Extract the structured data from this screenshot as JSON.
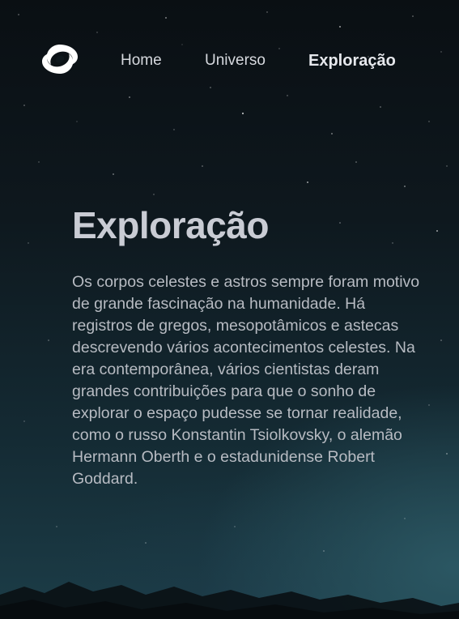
{
  "header": {
    "logo_icon": "spiral-logo-icon",
    "nav": {
      "home": "Home",
      "universo": "Universo",
      "exploracao": "Exploração"
    },
    "active_item": "Exploração"
  },
  "main": {
    "title": "Exploração",
    "paragraph": "Os corpos celestes e astros sempre foram motivo de grande fascinação na humanidade. Há registros de gregos, mesopotâmicos e astecas descrevendo vários acontecimentos celestes. Na era contemporânea, vários cientistas deram grandes contribuições para que o sonho de explorar o espaço pudesse se tornar realidade, como o russo Konstantin Tsiolkovsky, o alemão Hermann Oberth e o estadunidense Robert Goddard."
  },
  "colors": {
    "background_top": "#0a0f13",
    "background_bottom": "#1c3d48",
    "title": "#c9ccd4",
    "text": "#b7bbc2",
    "nav_text": "#d6d9de"
  }
}
